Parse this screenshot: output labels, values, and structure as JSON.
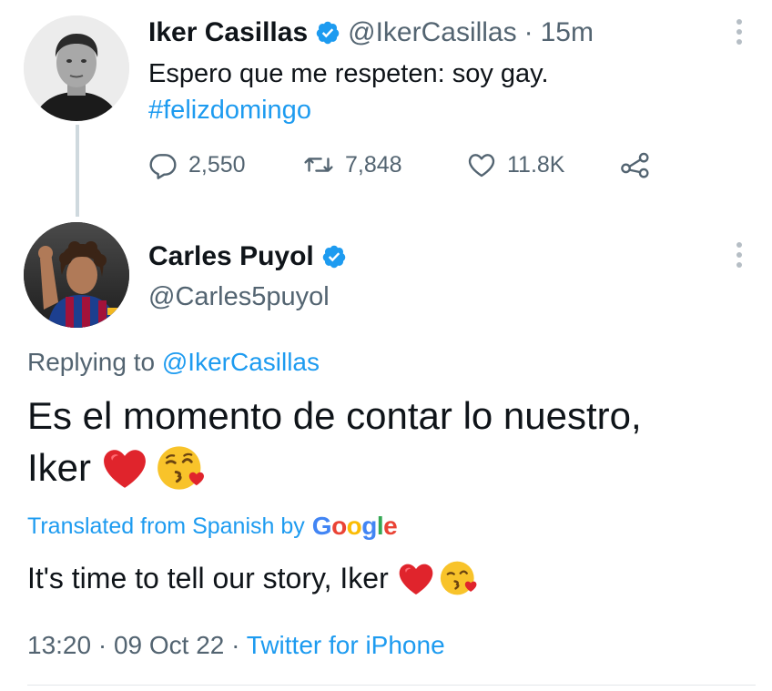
{
  "colors": {
    "link": "#1d9bf0",
    "text": "#0f1419",
    "muted": "#536471",
    "verified": "#1d9bf0",
    "heart": "#e0242c"
  },
  "original_tweet": {
    "display_name": "Iker Casillas",
    "handle": "@IkerCasillas",
    "separator": "·",
    "time": "15m",
    "text": "Espero que me respeten: soy gay.",
    "hashtag": "#felizdomingo",
    "replies": "2,550",
    "retweets": "7,848",
    "likes": "11.8K",
    "icons": [
      "verified-icon",
      "reply-icon",
      "retweet-icon",
      "like-icon",
      "share-icon",
      "more-icon"
    ]
  },
  "reply_tweet": {
    "display_name": "Carles Puyol",
    "handle": "@Carles5puyol",
    "replying_prefix": "Replying to",
    "replying_mention": "@IkerCasillas",
    "text_line1": "Es el momento de contar lo nuestro,",
    "text_line2": "Iker",
    "translated_label": "Translated from Spanish by",
    "translator": "Google",
    "translation": "It's time to tell our story, Iker",
    "timestamp_time": "13:20",
    "timestamp_date": "09 Oct 22",
    "separator": "·",
    "source": "Twitter for iPhone",
    "emojis": [
      "red-heart-emoji",
      "kissing-face-winking-emoji"
    ]
  }
}
